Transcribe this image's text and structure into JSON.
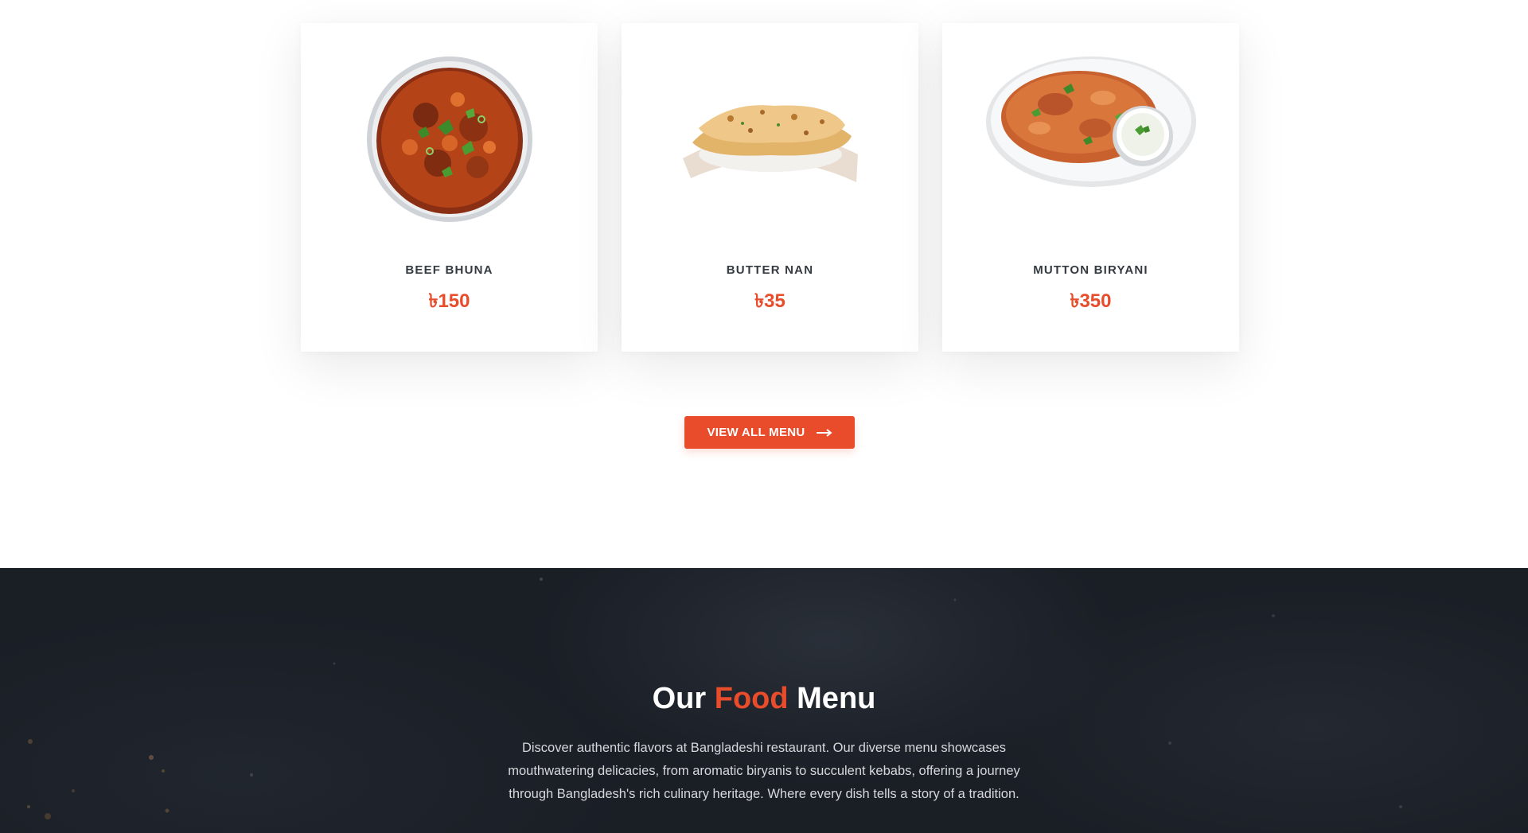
{
  "menu_items": [
    {
      "name": "BEEF BHUNA",
      "price": "৳150"
    },
    {
      "name": "BUTTER NAN",
      "price": "৳35"
    },
    {
      "name": "MUTTON BIRYANI",
      "price": "৳350"
    }
  ],
  "view_all_button": {
    "label": "VIEW ALL MENU",
    "icon": "arrow-right-icon"
  },
  "food_menu": {
    "title_part1": "Our",
    "title_accent": "Food",
    "title_part2": "Menu",
    "description": "Discover authentic flavors at Bangladeshi restaurant. Our diverse menu showcases mouthwatering delicacies, from aromatic biryanis to succulent kebabs, offering a journey through Bangladesh's rich culinary heritage. Where every dish tells a story of a tradition."
  },
  "colors": {
    "accent": "#e84c2b",
    "text_dark": "#333a40",
    "dark_bg": "#1a1e25"
  }
}
